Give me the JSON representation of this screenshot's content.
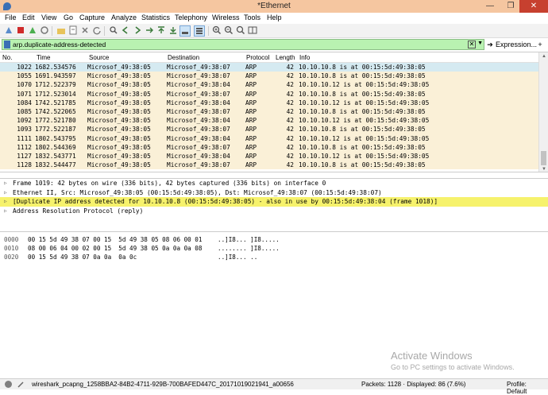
{
  "window": {
    "title": "*Ethernet",
    "minimize": "—",
    "maximize": "❐",
    "close": "✕"
  },
  "menu": [
    "File",
    "Edit",
    "View",
    "Go",
    "Capture",
    "Analyze",
    "Statistics",
    "Telephony",
    "Wireless",
    "Tools",
    "Help"
  ],
  "filter": {
    "value": "arp.duplicate-address-detected",
    "expression_label": "Expression...",
    "plus": "+"
  },
  "columns": [
    "No.",
    "Time",
    "Source",
    "Destination",
    "Protocol",
    "Length",
    "Info"
  ],
  "packets": [
    {
      "no": "1022",
      "time": "1682.534576",
      "src": "Microsof_49:38:05",
      "dst": "Microsof_49:38:07",
      "proto": "ARP",
      "len": "42",
      "info": "10.10.10.8 is at 00:15:5d:49:38:05"
    },
    {
      "no": "1055",
      "time": "1691.943597",
      "src": "Microsof_49:38:05",
      "dst": "Microsof_49:38:07",
      "proto": "ARP",
      "len": "42",
      "info": "10.10.10.8 is at 00:15:5d:49:38:05"
    },
    {
      "no": "1070",
      "time": "1712.522379",
      "src": "Microsof_49:38:05",
      "dst": "Microsof_49:38:04",
      "proto": "ARP",
      "len": "42",
      "info": "10.10.10.12 is at 00:15:5d:49:38:05"
    },
    {
      "no": "1071",
      "time": "1712.523014",
      "src": "Microsof_49:38:05",
      "dst": "Microsof_49:38:07",
      "proto": "ARP",
      "len": "42",
      "info": "10.10.10.8 is at 00:15:5d:49:38:05"
    },
    {
      "no": "1084",
      "time": "1742.521785",
      "src": "Microsof_49:38:05",
      "dst": "Microsof_49:38:04",
      "proto": "ARP",
      "len": "42",
      "info": "10.10.10.12 is at 00:15:5d:49:38:05"
    },
    {
      "no": "1085",
      "time": "1742.522065",
      "src": "Microsof_49:38:05",
      "dst": "Microsof_49:38:07",
      "proto": "ARP",
      "len": "42",
      "info": "10.10.10.8 is at 00:15:5d:49:38:05"
    },
    {
      "no": "1092",
      "time": "1772.521780",
      "src": "Microsof_49:38:05",
      "dst": "Microsof_49:38:04",
      "proto": "ARP",
      "len": "42",
      "info": "10.10.10.12 is at 00:15:5d:49:38:05"
    },
    {
      "no": "1093",
      "time": "1772.522187",
      "src": "Microsof_49:38:05",
      "dst": "Microsof_49:38:07",
      "proto": "ARP",
      "len": "42",
      "info": "10.10.10.8 is at 00:15:5d:49:38:05"
    },
    {
      "no": "1111",
      "time": "1802.543795",
      "src": "Microsof_49:38:05",
      "dst": "Microsof_49:38:04",
      "proto": "ARP",
      "len": "42",
      "info": "10.10.10.12 is at 00:15:5d:49:38:05"
    },
    {
      "no": "1112",
      "time": "1802.544369",
      "src": "Microsof_49:38:05",
      "dst": "Microsof_49:38:07",
      "proto": "ARP",
      "len": "42",
      "info": "10.10.10.8 is at 00:15:5d:49:38:05"
    },
    {
      "no": "1127",
      "time": "1832.543771",
      "src": "Microsof_49:38:05",
      "dst": "Microsof_49:38:04",
      "proto": "ARP",
      "len": "42",
      "info": "10.10.10.12 is at 00:15:5d:49:38:05"
    },
    {
      "no": "1128",
      "time": "1832.544477",
      "src": "Microsof_49:38:05",
      "dst": "Microsof_49:38:07",
      "proto": "ARP",
      "len": "42",
      "info": "10.10.10.8 is at 00:15:5d:49:38:05"
    }
  ],
  "details": [
    {
      "text": "Frame 1019: 42 bytes on wire (336 bits), 42 bytes captured (336 bits) on interface 0",
      "warn": false
    },
    {
      "text": "Ethernet II, Src: Microsof_49:38:05 (00:15:5d:49:38:05), Dst: Microsof_49:38:07 (00:15:5d:49:38:07)",
      "warn": false
    },
    {
      "text": "[Duplicate IP address detected for 10.10.10.8 (00:15:5d:49:38:05) - also in use by 00:15:5d:49:38:04 (frame 1018)]",
      "warn": true
    },
    {
      "text": "Address Resolution Protocol (reply)",
      "warn": false
    }
  ],
  "hex": [
    {
      "offset": "0000",
      "bytes": "00 15 5d 49 38 07 00 15  5d 49 38 05 08 06 00 01",
      "ascii": "..]I8... ]I8....."
    },
    {
      "offset": "0010",
      "bytes": "08 00 06 04 00 02 00 15  5d 49 38 05 0a 0a 0a 08",
      "ascii": "........ ]I8....."
    },
    {
      "offset": "0020",
      "bytes": "00 15 5d 49 38 07 0a 0a  0a 0c",
      "ascii": "..]I8... .."
    }
  ],
  "watermark": {
    "line1": "Activate Windows",
    "line2": "Go to PC settings to activate Windows."
  },
  "status": {
    "file": "wireshark_pcapng_1258BBA2-84B2-4711-929B-700BAFED447C_20171019021941_a00656",
    "packets": "Packets: 1128 · Displayed: 86 (7.6%)",
    "profile": "Profile: Default"
  }
}
